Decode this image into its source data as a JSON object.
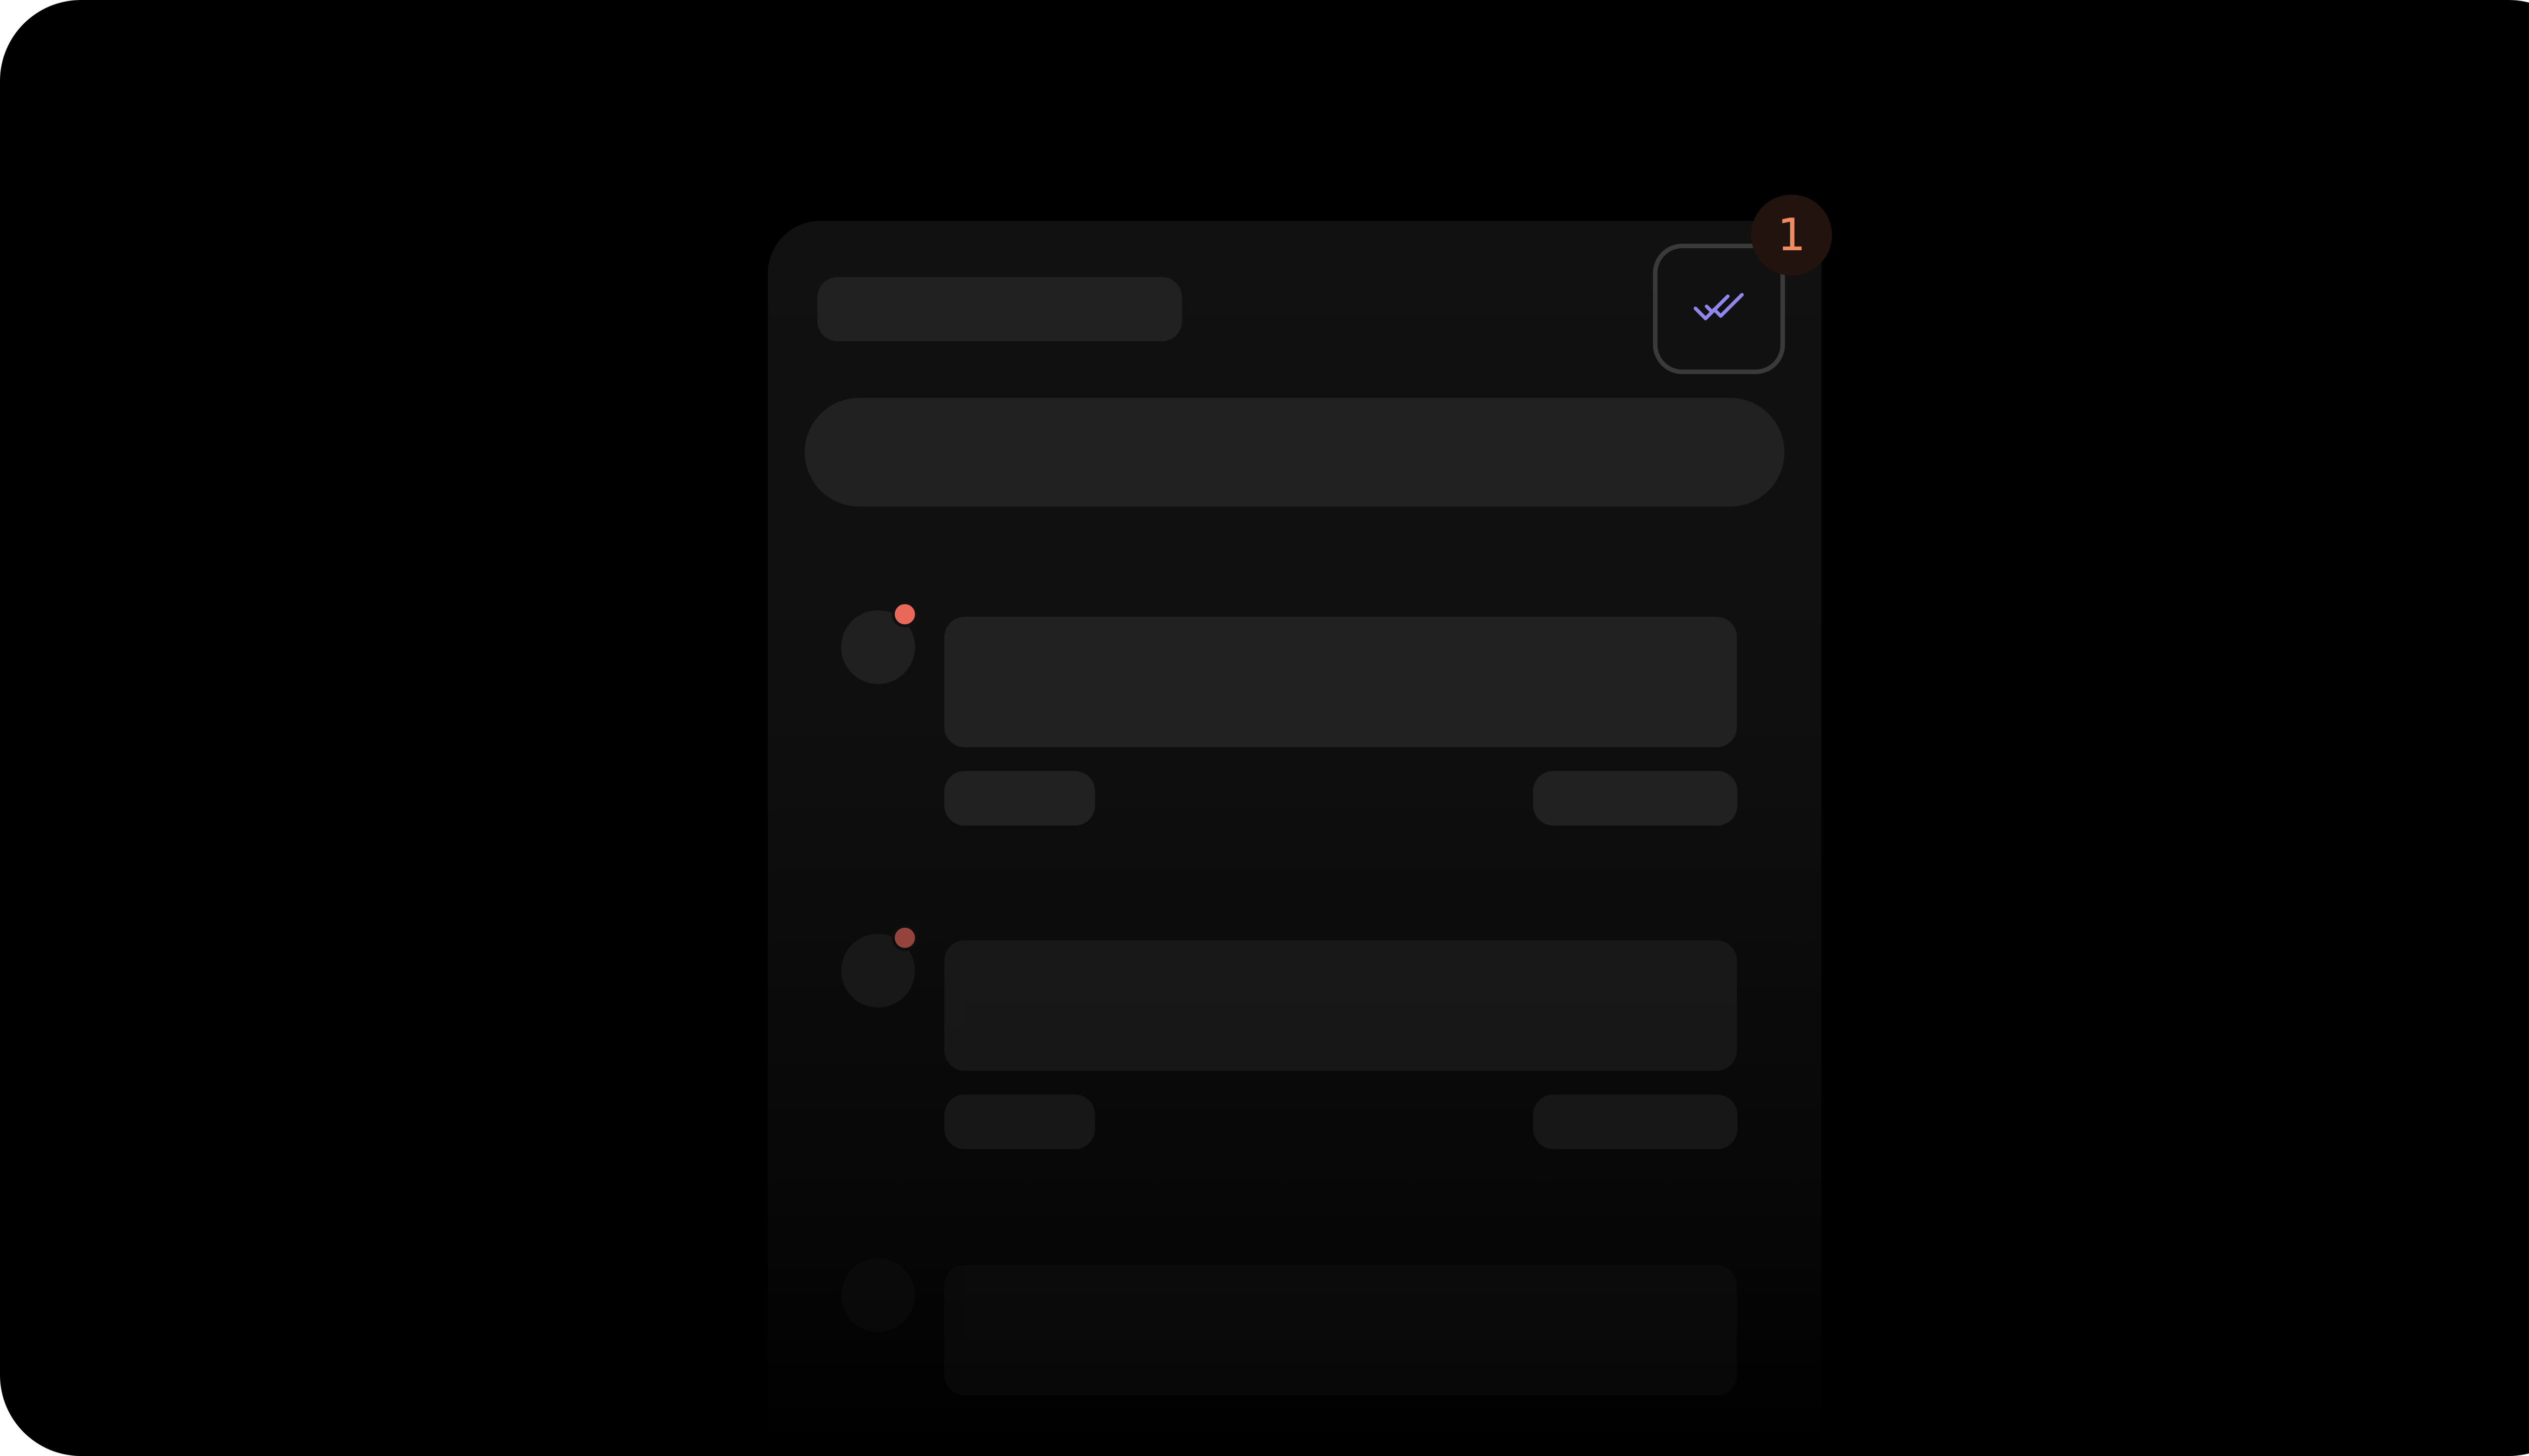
{
  "header": {
    "mark_all_read_icon": "double-check-icon",
    "unread_count": "1"
  },
  "colors": {
    "accent": "#8f86ee",
    "badge_text": "#ef8a62",
    "unread_dot": "#e8685a",
    "unread_dot_dim": "#9b3f3c"
  },
  "notifications": [
    {
      "state": "unread"
    },
    {
      "state": "unread-dim"
    },
    {
      "state": "faded"
    }
  ]
}
